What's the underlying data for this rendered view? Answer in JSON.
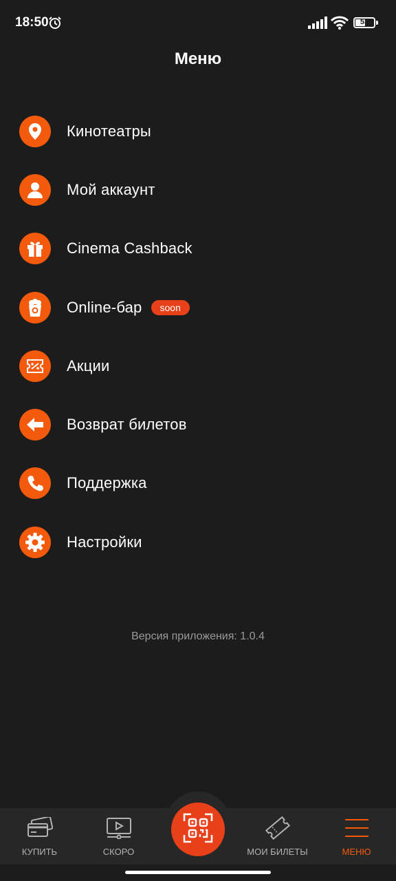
{
  "status": {
    "time": "18:50",
    "battery": "53",
    "battery_level": 0.53
  },
  "header": {
    "title": "Меню"
  },
  "menu": {
    "items": [
      {
        "label": "Кинотеатры",
        "icon": "location-pin-icon"
      },
      {
        "label": "Мой аккаунт",
        "icon": "user-icon"
      },
      {
        "label": "Cinema Cashback",
        "icon": "gift-icon"
      },
      {
        "label": "Online-бар",
        "icon": "popcorn-icon",
        "badge": "soon"
      },
      {
        "label": "Акции",
        "icon": "discount-ticket-icon"
      },
      {
        "label": "Возврат билетов",
        "icon": "arrow-left-icon"
      },
      {
        "label": "Поддержка",
        "icon": "phone-icon"
      },
      {
        "label": "Настройки",
        "icon": "gear-icon"
      }
    ]
  },
  "footer": {
    "version": "Версия приложения: 1.0.4"
  },
  "tabbar": {
    "tabs": [
      {
        "label": "КУПИТЬ",
        "icon": "credit-cards-icon"
      },
      {
        "label": "СКОРО",
        "icon": "video-play-icon"
      },
      {
        "label": "",
        "icon": "qr-code-icon"
      },
      {
        "label": "МОИ БИЛЕТЫ",
        "icon": "ticket-icon"
      },
      {
        "label": "МЕНЮ",
        "icon": "hamburger-menu-icon",
        "active": true
      }
    ]
  },
  "colors": {
    "accent": "#f35a0c",
    "badge": "#e8411a",
    "background": "#1c1c1c",
    "tabbar": "#272727"
  }
}
